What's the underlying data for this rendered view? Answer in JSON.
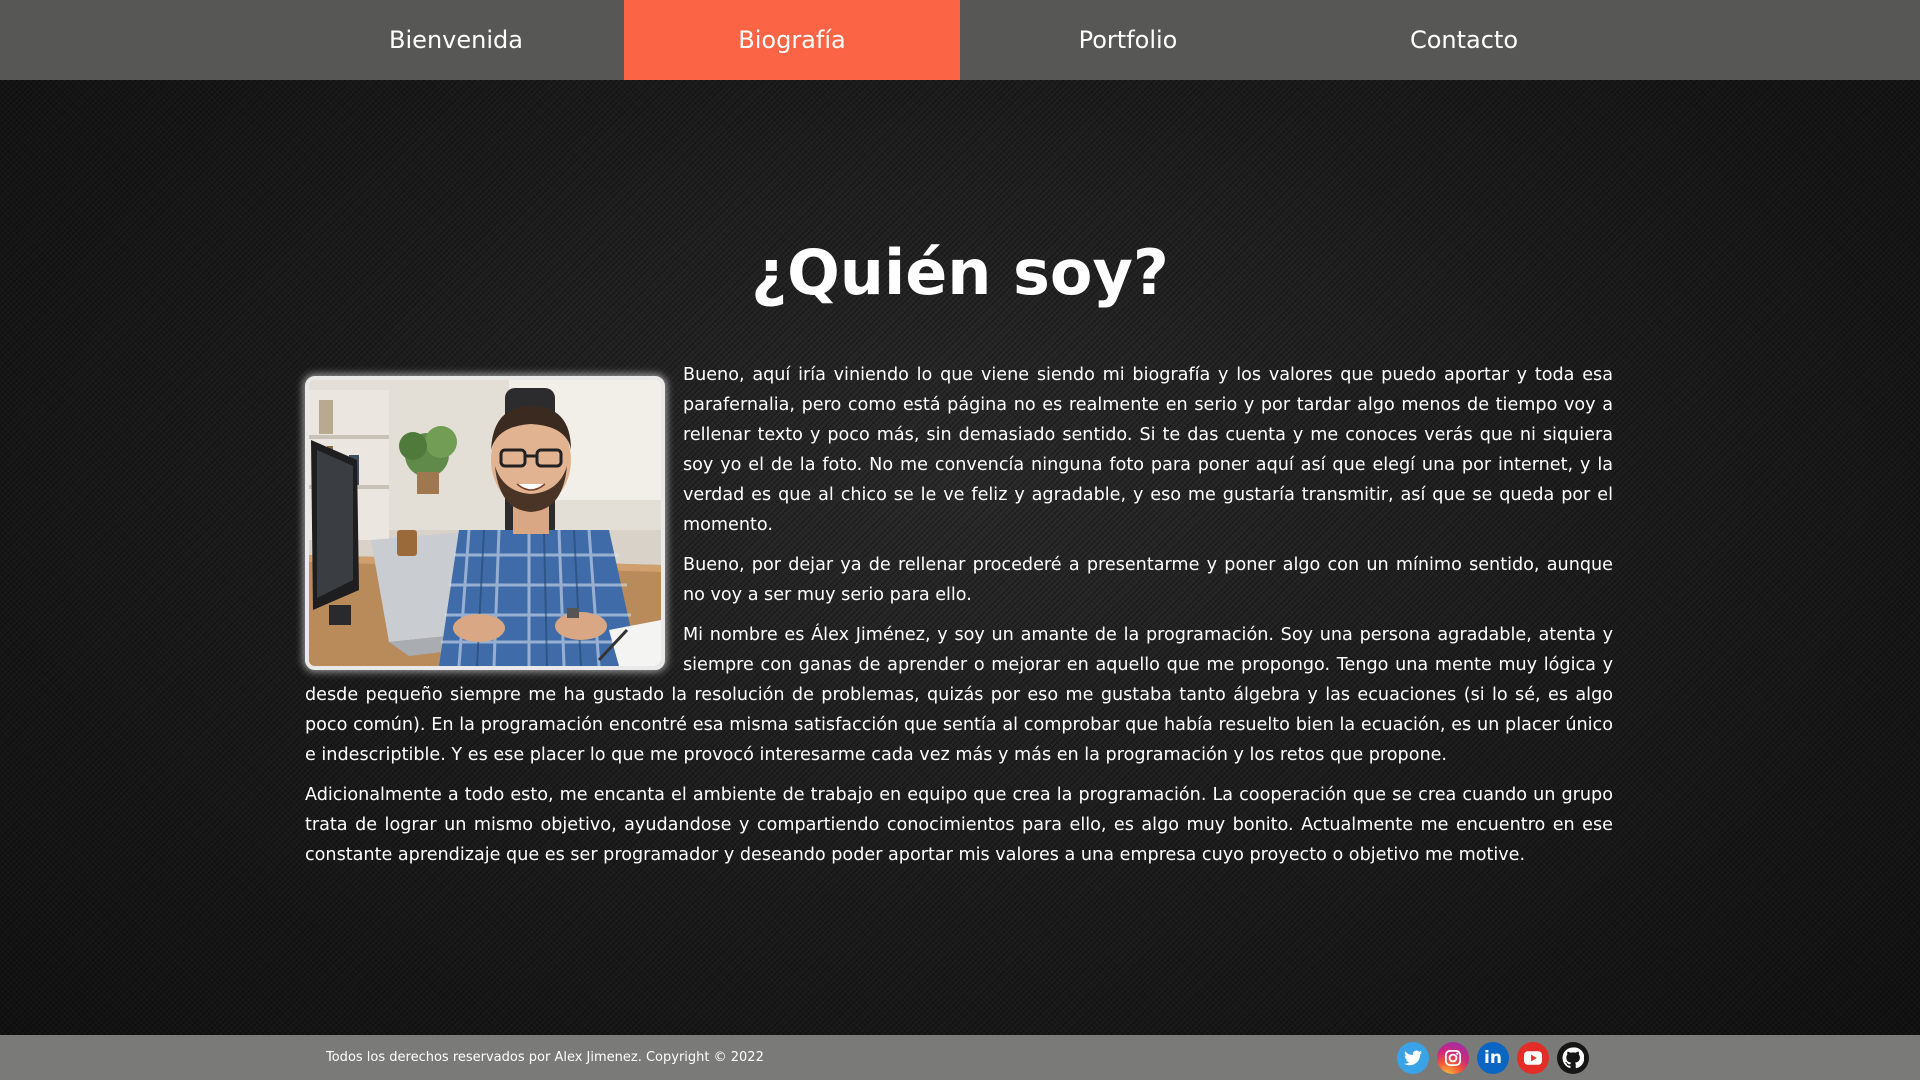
{
  "nav": {
    "items": [
      {
        "label": "Bienvenida",
        "active": false
      },
      {
        "label": "Biografía",
        "active": true
      },
      {
        "label": "Portfolio",
        "active": false
      },
      {
        "label": "Contacto",
        "active": false
      }
    ]
  },
  "main": {
    "title": "¿Quién soy?",
    "photo_icon": "profile-photo-man-at-desk",
    "paragraphs": [
      "Bueno, aquí iría viniendo lo que viene siendo mi biografía y los valores que puedo aportar y toda esa parafernalia, pero como está página no es realmente en serio y por tardar algo menos de tiempo voy a rellenar texto y poco más, sin demasiado sentido. Si te das cuenta y me conoces verás que ni siquiera soy yo el de la foto. No me convencía ninguna foto para poner aquí así que elegí una por internet, y la verdad es que al chico se le ve feliz y agradable, y eso me gustaría transmitir, así que se queda por el momento.",
      "Bueno, por dejar ya de rellenar procederé a presentarme y poner algo con un mínimo sentido, aunque no voy a ser muy serio para ello.",
      "Mi nombre es Álex Jiménez, y soy un amante de la programación. Soy una persona agradable, atenta y siempre con ganas de aprender o mejorar en aquello que me propongo. Tengo una mente muy lógica y desde pequeño siempre me ha gustado la resolución de problemas, quizás por eso me gustaba tanto álgebra y las ecuaciones (si lo sé, es algo poco común). En la programación encontré esa misma satisfacción que sentía al comprobar que había resuelto bien la ecuación, es un placer único e indescriptible. Y es ese placer lo que me provocó interesarme cada vez más y más en la programación y los retos que propone.",
      "Adicionalmente a todo esto, me encanta el ambiente de trabajo en equipo que crea la programación. La cooperación que se crea cuando un grupo trata de lograr un mismo objetivo, ayudandose y compartiendo conocimientos para ello, es algo muy bonito. Actualmente me encuentro en ese constante aprendizaje que es ser programador y deseando poder aportar mis valores a una empresa cuyo proyecto o objetivo me motive."
    ]
  },
  "footer": {
    "copyright": "Todos los derechos reservados por Alex Jimenez. Copyright © 2022",
    "social": [
      {
        "icon": "twitter-icon",
        "color": "#3aa3e8"
      },
      {
        "icon": "instagram-icon",
        "color": "#d1267b"
      },
      {
        "icon": "linkedin-icon",
        "color": "#0a66c2",
        "text": "in"
      },
      {
        "icon": "youtube-icon",
        "color": "#e52d27"
      },
      {
        "icon": "github-icon",
        "color": "#161616"
      }
    ]
  },
  "colors": {
    "nav_bg": "#575755",
    "nav_active": "#fb6445",
    "footer_bg": "#7a7a78",
    "page_bg": "#181818",
    "text": "#ffffff"
  }
}
